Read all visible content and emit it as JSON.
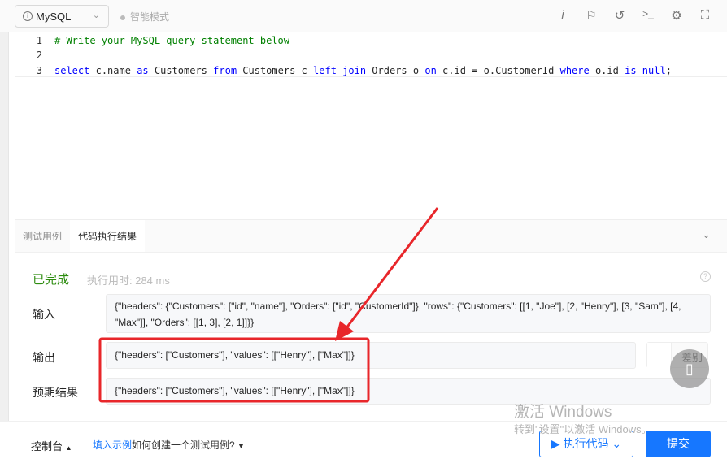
{
  "toolbar": {
    "language": "MySQL",
    "mode": "智能模式",
    "icons": [
      "info-icon",
      "flag-icon",
      "reset-icon",
      "terminal-icon",
      "settings-icon",
      "fullscreen-icon"
    ]
  },
  "editor": {
    "lines": [
      {
        "num": "1",
        "text": "# Write your MySQL query statement below"
      },
      {
        "num": "2",
        "text": ""
      },
      {
        "num": "3",
        "text": "select c.name as Customers from Customers c left join Orders o on c.id = o.CustomerId where o.id is null;"
      }
    ]
  },
  "panel": {
    "tabs": [
      "测试用例",
      "代码执行结果"
    ],
    "active_tab": "代码执行结果",
    "status": "已完成",
    "time_label": "执行用时: 284 ms",
    "input_label": "输入",
    "input_value": "{\"headers\": {\"Customers\": [\"id\", \"name\"], \"Orders\": [\"id\", \"CustomerId\"]}, \"rows\": {\"Customers\": [[1, \"Joe\"], [2, \"Henry\"], [3, \"Sam\"], [4, \"Max\"]], \"Orders\": [[1, 3], [2, 1]]}}",
    "output_label": "输出",
    "output_value": "{\"headers\": [\"Customers\"], \"values\": [[\"Henry\"], [\"Max\"]]}",
    "expected_label": "预期结果",
    "expected_value": "{\"headers\": [\"Customers\"], \"values\": [[\"Henry\"], [\"Max\"]]}",
    "diff_label": "差别"
  },
  "footer": {
    "console": "控制台",
    "fill_example": "填入示例",
    "how_to": "如何创建一个测试用例?",
    "run": "执行代码",
    "submit": "提交"
  },
  "watermark": {
    "line1": "激活 Windows",
    "line2": "转到\"设置\"以激活 Windows。"
  },
  "annotation_color": "#e8262a"
}
